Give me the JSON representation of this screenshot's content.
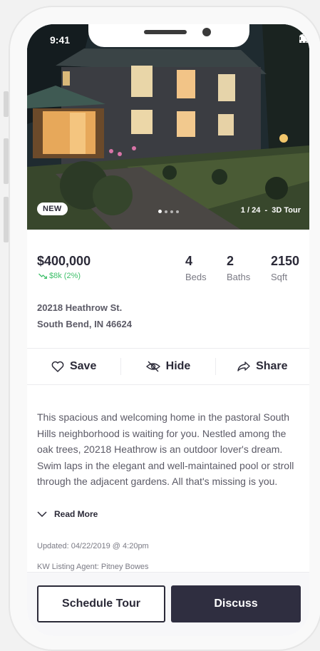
{
  "status_bar": {
    "time": "9:41"
  },
  "hero": {
    "badge": "NEW",
    "photo_index": "1 / 24",
    "separator": "-",
    "tour_label": "3D Tour",
    "dots_total": 4,
    "dots_active": 1
  },
  "listing": {
    "price": "$400,000",
    "price_change": "$8k (2%)",
    "beds_value": "4",
    "beds_label": "Beds",
    "baths_value": "2",
    "baths_label": "Baths",
    "sqft_value": "2150",
    "sqft_label": "Sqft",
    "address_line1": "20218 Heathrow St.",
    "address_line2": "South Bend, IN 46624"
  },
  "actions": {
    "save": "Save",
    "hide": "Hide",
    "share": "Share"
  },
  "description": "This spacious and welcoming home in the pastoral South Hills neighborhood is waiting for you. Nestled among the oak trees, 20218 Heathrow is an outdoor lover's dream. Swim laps in the elegant and well-maintained pool or stroll through the adjacent gardens. All that's missing is you.",
  "read_more": "Read More",
  "meta": {
    "updated": "Updated: 04/22/2019 @ 4:20pm",
    "agent": "KW Listing Agent: Pitney Bowes"
  },
  "buttons": {
    "schedule": "Schedule Tour",
    "discuss": "Discuss"
  },
  "colors": {
    "primary_dark": "#2f2e40",
    "price_up_green": "#3fc06b",
    "text_muted": "#7a7a84"
  }
}
